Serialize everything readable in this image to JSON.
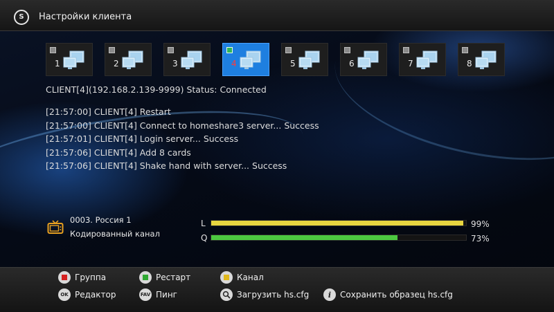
{
  "header": {
    "title": "Настройки клиента",
    "logo_text": "S"
  },
  "clients": [
    {
      "number": "1",
      "active": false
    },
    {
      "number": "2",
      "active": false
    },
    {
      "number": "3",
      "active": false
    },
    {
      "number": "4",
      "active": true
    },
    {
      "number": "5",
      "active": false
    },
    {
      "number": "6",
      "active": false
    },
    {
      "number": "7",
      "active": false
    },
    {
      "number": "8",
      "active": false
    }
  ],
  "status_line": "CLIENT[4](192.168.2.139-9999) Status: Connected",
  "log": [
    "[21:57:00] CLIENT[4] Restart",
    "[21:57:00] CLIENT[4] Connect to homeshare3 server... Success",
    "[21:57:01] CLIENT[4] Login server... Success",
    "[21:57:06] CLIENT[4] Add 8 cards",
    "[21:57:06] CLIENT[4] Shake hand with server... Success"
  ],
  "channel": {
    "line1": "0003.  Россия 1",
    "line2": "Кодированный канал",
    "icon": "tv-icon"
  },
  "signal": {
    "level": {
      "label": "L",
      "value_text": "99%",
      "value": 99,
      "color": "#e8d640"
    },
    "quality": {
      "label": "Q",
      "value_text": "73%",
      "value": 73,
      "color": "#4cc840"
    }
  },
  "footer": {
    "red": {
      "label": "Группа",
      "color": "#d42020"
    },
    "green": {
      "label": "Рестарт",
      "color": "#2fa832"
    },
    "yellow": {
      "label": "Канал",
      "color": "#e0b81c"
    },
    "ok": {
      "key": "OK",
      "label": "Редактор"
    },
    "fav": {
      "key": "FAV",
      "label": "Пинг"
    },
    "search": {
      "label": "Загрузить  hs.cfg",
      "icon": "search-icon"
    },
    "info": {
      "label": "Сохранить образец hs.cfg",
      "icon": "info-icon"
    }
  }
}
